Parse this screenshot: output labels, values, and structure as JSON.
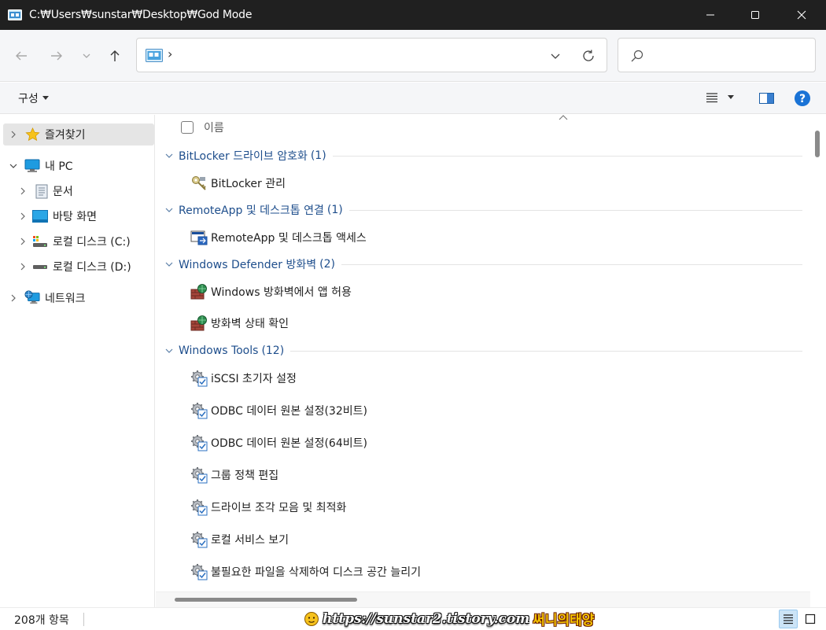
{
  "window": {
    "title": "C:₩Users₩sunstar₩Desktop₩God Mode"
  },
  "address": {
    "chevron": "›",
    "search_placeholder": ""
  },
  "toolbar": {
    "organize_label": "구성"
  },
  "nav": {
    "favorites": "즐겨찾기",
    "this_pc": "내 PC",
    "documents": "문서",
    "desktop": "바탕 화면",
    "drive_c": "로컬 디스크 (C:)",
    "drive_d": "로컬 디스크 (D:)",
    "network": "네트워크"
  },
  "content": {
    "column_name": "이름",
    "groups": [
      {
        "label": "BitLocker 드라이브 암호화",
        "count": "(1)"
      },
      {
        "label": "RemoteApp 및 데스크톱 연결",
        "count": "(1)"
      },
      {
        "label": "Windows Defender 방화벽",
        "count": "(2)"
      },
      {
        "label": "Windows Tools",
        "count": "(12)"
      }
    ],
    "items": [
      {
        "label": "BitLocker 관리",
        "icon": "bitlocker-key-icon"
      },
      {
        "label": "RemoteApp 및 데스크톱 액세스",
        "icon": "remoteapp-icon"
      },
      {
        "label": "Windows 방화벽에서 앱 허용",
        "icon": "firewall-icon"
      },
      {
        "label": "방화벽 상태 확인",
        "icon": "firewall-icon"
      },
      {
        "label": "iSCSI 초기자 설정",
        "icon": "admin-tool-icon"
      },
      {
        "label": "ODBC 데이터 원본 설정(32비트)",
        "icon": "admin-tool-icon"
      },
      {
        "label": "ODBC 데이터 원본 설정(64비트)",
        "icon": "admin-tool-icon"
      },
      {
        "label": "그룹 정책 편집",
        "icon": "admin-tool-icon"
      },
      {
        "label": "드라이브 조각 모음 및 최적화",
        "icon": "admin-tool-icon"
      },
      {
        "label": "로컬 서비스 보기",
        "icon": "admin-tool-icon"
      },
      {
        "label": "불필요한 파일을 삭제하여 디스크 공간 늘리기",
        "icon": "admin-tool-icon"
      }
    ]
  },
  "status": {
    "item_count": "208개 항목"
  },
  "watermark": {
    "url": "https://sunstar2.tistory.com",
    "name": "써니의태양"
  },
  "colors": {
    "titlebar": "#202020",
    "group_text": "#1e4e8c",
    "accent": "#0067c0"
  }
}
